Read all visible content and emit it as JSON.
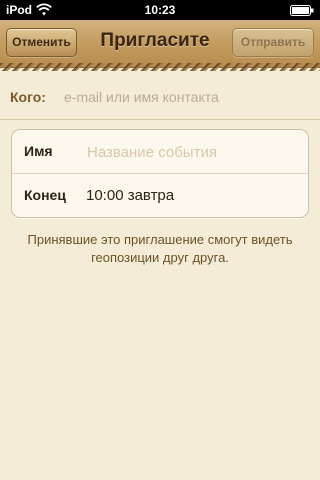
{
  "status_bar": {
    "carrier": "iPod",
    "time": "10:23",
    "wifi_icon": "wifi-icon",
    "battery_icon": "battery-icon"
  },
  "nav": {
    "title": "Пригласите",
    "cancel_label": "Отменить",
    "send_label": "Отправить"
  },
  "to_field": {
    "label": "Кого:",
    "placeholder": "e-mail или имя контакта",
    "value": ""
  },
  "form": {
    "name_label": "Имя",
    "name_placeholder": "Название события",
    "end_label": "Конец",
    "end_value": "10:00 завтра"
  },
  "note": "Принявшие это приглашение смогут видеть геопозиции друг друга.",
  "colors": {
    "background": "#f4ecd6",
    "nav_leather": "#c59e62",
    "accent_brown": "#7d5a2b"
  }
}
